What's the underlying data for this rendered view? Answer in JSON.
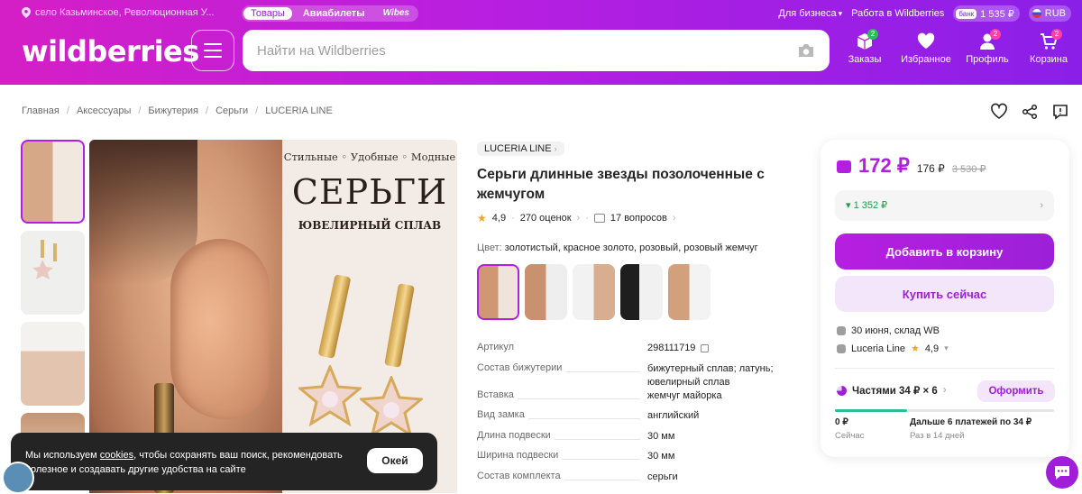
{
  "topbar": {
    "location": "село Казьминское, Революционная У...",
    "tabs": [
      "Товары",
      "Авиабилеты",
      "Wibes"
    ],
    "for_business": "Для бизнеса",
    "work": "Работа в Wildberries",
    "bank_tag": "банк",
    "bank_amount": "1 535 ₽",
    "currency": "RUB"
  },
  "header": {
    "logo": "wildberries",
    "search_placeholder": "Найти на Wildberries",
    "nav": [
      {
        "label": "Заказы",
        "icon": "box-icon",
        "badge": "2"
      },
      {
        "label": "Избранное",
        "icon": "heart-icon",
        "badge": ""
      },
      {
        "label": "Профиль",
        "icon": "user-icon",
        "badge": "2"
      },
      {
        "label": "Корзина",
        "icon": "cart-icon",
        "badge": "2"
      }
    ]
  },
  "breadcrumbs": [
    "Главная",
    "Аксессуары",
    "Бижутерия",
    "Серьги",
    "LUCERIA LINE"
  ],
  "image": {
    "tagline": "Стильные ◦ Удобные ◦ Модные",
    "big": "СЕРЬГИ",
    "sub": "ЮВЕЛИРНЫЙ СПЛАВ"
  },
  "cookie": {
    "text_before": "Мы используем ",
    "link": "cookies",
    "text_after": ", чтобы сохранять ваш поиск, рекомендовать полезное и создавать другие удобства на сайте",
    "button": "Окей"
  },
  "product": {
    "brand": "LUCERIA LINE",
    "title": "Серьги длинные звезды позолоченные с жемчугом",
    "rating": "4,9",
    "reviews": "270 оценок",
    "questions": "17 вопросов",
    "color_label": "Цвет:",
    "color_value": "золотистый, красное золото, розовый, розовый жемчуг",
    "specs": [
      {
        "key": "Артикул",
        "value": "298111719"
      },
      {
        "key": "Состав бижутерии",
        "value": "бижутерный сплав; латунь; ювелирный сплав"
      },
      {
        "key": "Вставка",
        "value": "жемчуг майорка"
      },
      {
        "key": "Вид замка",
        "value": "английский"
      },
      {
        "key": "Длина подвески",
        "value": "30 мм"
      },
      {
        "key": "Ширина подвески",
        "value": "30 мм"
      },
      {
        "key": "Состав комплекта",
        "value": "серьги"
      }
    ]
  },
  "card": {
    "price": "172 ₽",
    "price_regular": "176 ₽",
    "price_old": "3 530 ₽",
    "bonus": "▾ 1 352 ₽",
    "add_to_cart": "Добавить в корзину",
    "buy_now": "Купить сейчас",
    "delivery": "30 июня, склад WB",
    "seller": "Luceria Line",
    "seller_rating": "4,9",
    "installments": "Частями 34 ₽ × 6",
    "order_button": "Оформить",
    "installment_progress": 0.33,
    "pay_now": "0 ₽",
    "pay_now_sub": "Сейчас",
    "pay_later": "Дальше 6 платежей по 34 ₽",
    "pay_later_sub": "Раз в 14 дней"
  },
  "colors": {
    "accent": "#a11ed8",
    "header_start": "#d51fc6",
    "header_end": "#8a1fe8",
    "bonus_green": "#1c9d4a"
  }
}
